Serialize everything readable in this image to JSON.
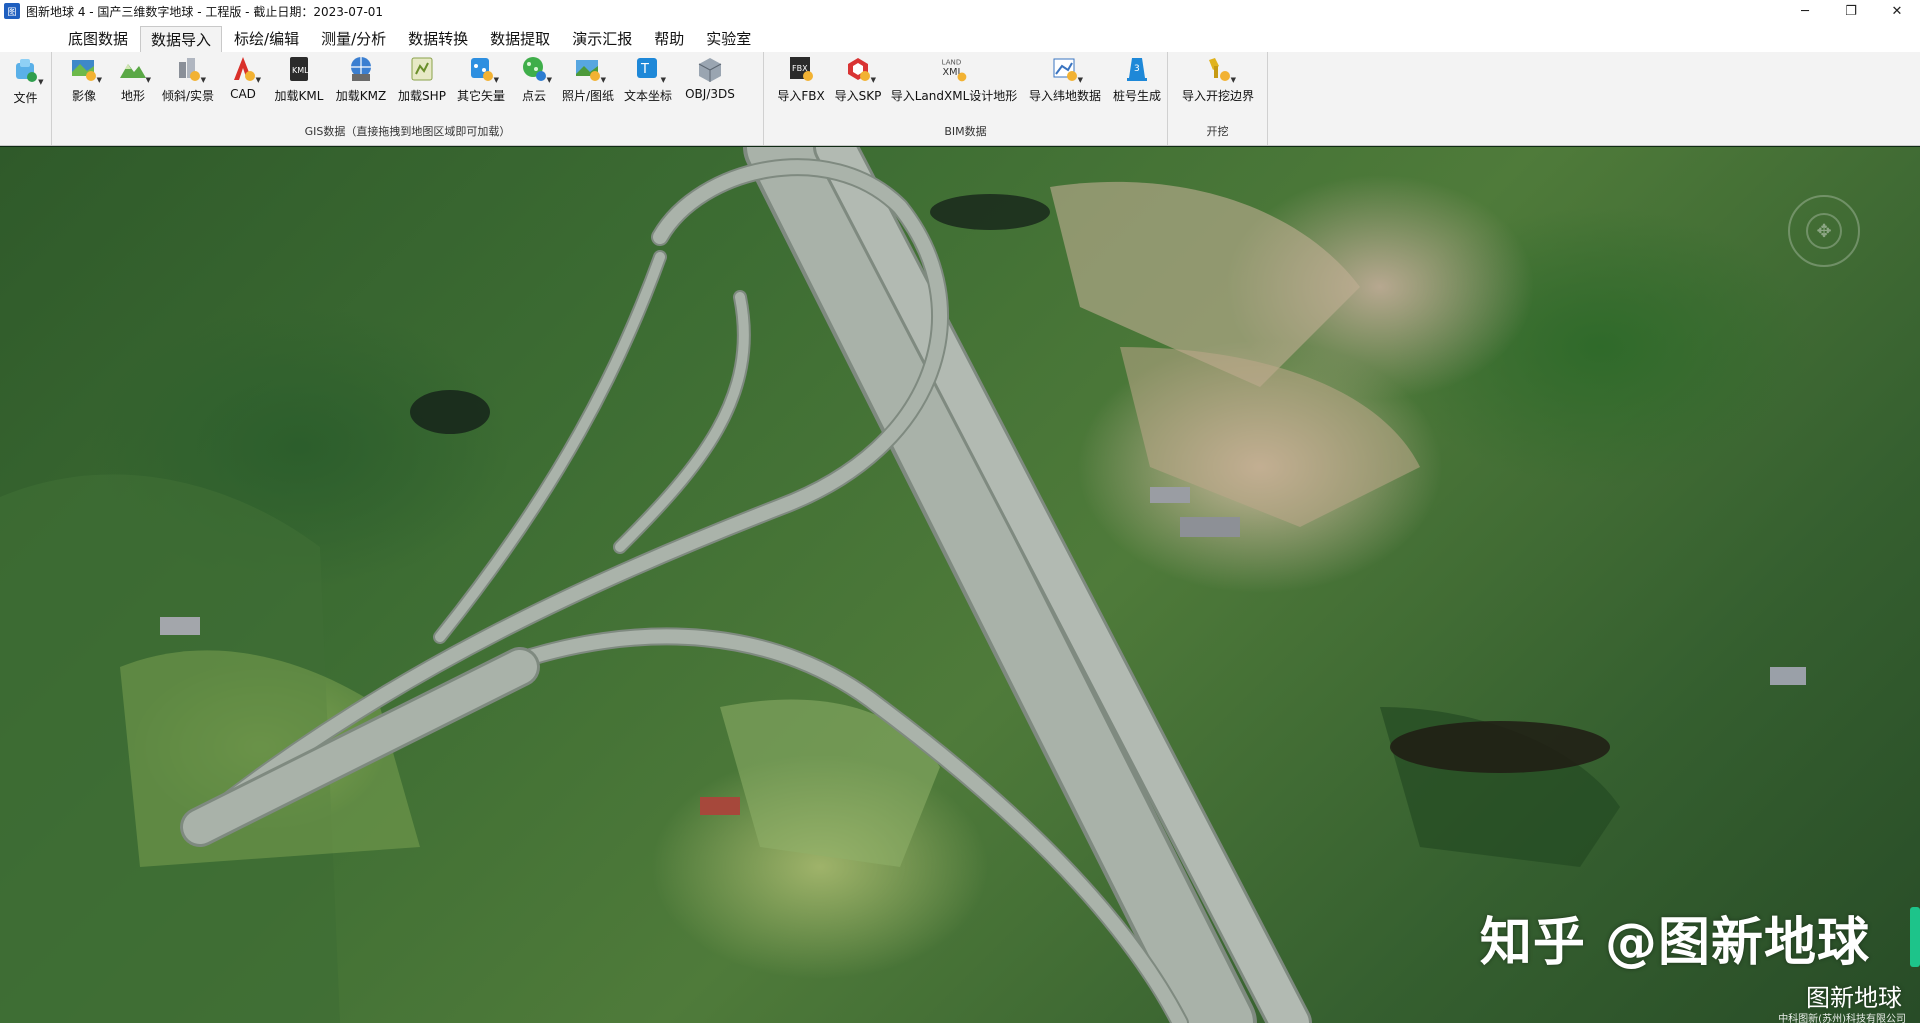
{
  "titlebar": {
    "app_icon_text": "图",
    "title": "图新地球 4 - 国产三维数字地球 - 工程版 - 截止日期：2023-07-01",
    "minimize": "─",
    "restore": "❐",
    "close": "✕"
  },
  "menu": [
    "底图数据",
    "数据导入",
    "标绘/编辑",
    "测量/分析",
    "数据转换",
    "数据提取",
    "演示汇报",
    "帮助",
    "实验室"
  ],
  "ribbon": {
    "file": {
      "label": "文件",
      "icon": "file-icon"
    },
    "gis_group": {
      "label": "GIS数据（直接拖拽到地图区域即可加载）",
      "tools": [
        {
          "label": "影像",
          "icon": "imagery-icon",
          "dropdown": true
        },
        {
          "label": "地形",
          "icon": "terrain-icon",
          "dropdown": true
        },
        {
          "label": "倾斜/实景",
          "icon": "oblique-icon",
          "dropdown": true
        },
        {
          "label": "CAD",
          "icon": "cad-icon",
          "dropdown": true
        },
        {
          "label": "加载KML",
          "icon": "kml-icon",
          "dropdown": false
        },
        {
          "label": "加载KMZ",
          "icon": "kmz-icon",
          "dropdown": false
        },
        {
          "label": "加载SHP",
          "icon": "shp-icon",
          "dropdown": false
        },
        {
          "label": "其它矢量",
          "icon": "vector-icon",
          "dropdown": true
        },
        {
          "label": "点云",
          "icon": "pointcloud-icon",
          "dropdown": true
        },
        {
          "label": "照片/图纸",
          "icon": "photo-icon",
          "dropdown": true
        },
        {
          "label": "文本坐标",
          "icon": "text-coord-icon",
          "dropdown": true
        },
        {
          "label": "OBJ/3DS",
          "icon": "obj-icon",
          "dropdown": false
        }
      ]
    },
    "bim_group": {
      "label": "BIM数据",
      "tools": [
        {
          "label": "导入FBX",
          "icon": "fbx-icon",
          "dropdown": false
        },
        {
          "label": "导入SKP",
          "icon": "skp-icon",
          "dropdown": true
        },
        {
          "label": "导入LandXML设计地形",
          "icon": "landxml-icon",
          "dropdown": false
        },
        {
          "label": "导入纬地数据",
          "icon": "weidi-icon",
          "dropdown": true
        },
        {
          "label": "桩号生成",
          "icon": "station-icon",
          "dropdown": false
        }
      ]
    },
    "excavation_group": {
      "label": "开挖",
      "tools": [
        {
          "label": "导入开挖边界",
          "icon": "excavation-boundary-icon",
          "dropdown": true
        }
      ]
    }
  },
  "watermark": {
    "main": "知乎 @图新地球",
    "sub": "图新地球",
    "company": "中科图新(苏州)科技有限公司"
  },
  "colors": {
    "road": "#a9b2a9",
    "road_edge": "#7f8a80",
    "accent_scroll": "#1dc48a"
  }
}
